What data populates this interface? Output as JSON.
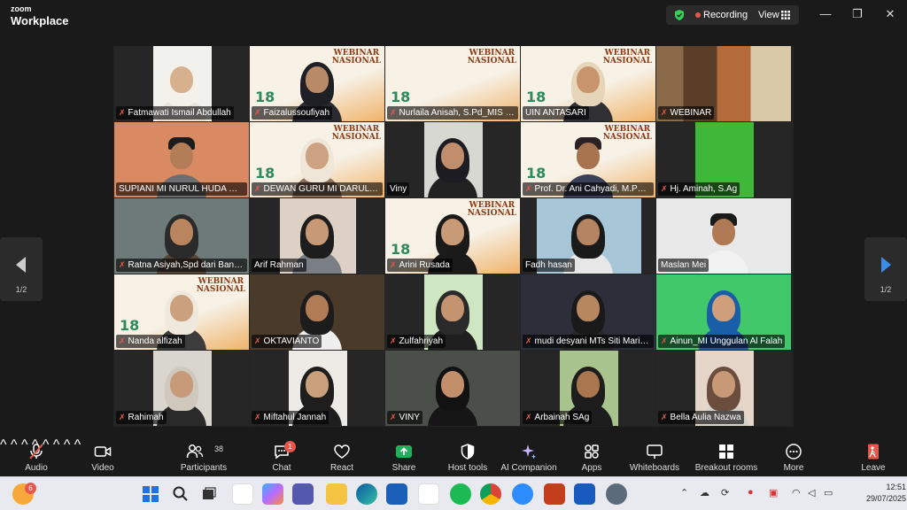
{
  "titlebar": {
    "logo_line1": "zoom",
    "logo_line2": "Workplace",
    "recording_label": "Recording",
    "view_label": "View",
    "minimize": "—",
    "maximize": "❐",
    "close": "✕"
  },
  "gallery": {
    "page_left": "1/2",
    "page_right": "1/2",
    "tiles": [
      {
        "name": "Fatmawati Ismail Abdullah",
        "muted": true
      },
      {
        "name": "Faizalussoufiyah",
        "muted": true
      },
      {
        "name": "Nurlaila Anisah, S.Pd_MIS Nurul Hikmah",
        "muted": true
      },
      {
        "name": "UIN ANTASARI",
        "muted": false
      },
      {
        "name": "WEBINAR",
        "muted": true
      },
      {
        "name": "SUPIANI MI NURUL HUDA MANDIANGIN",
        "muted": false
      },
      {
        "name": "DEWAN GURU MI DARUL FALAH",
        "muted": true
      },
      {
        "name": "Viny",
        "muted": false
      },
      {
        "name": "Prof. Dr. Ani Cahyadi, M.Pd/UIN",
        "muted": true
      },
      {
        "name": "Hj. Aminah, S.Ag",
        "muted": true
      },
      {
        "name": "Ratna Asiyah,Spd dari Banjarbaru",
        "muted": true
      },
      {
        "name": "Arif Rahman",
        "muted": false
      },
      {
        "name": "Arini Rusada",
        "muted": true
      },
      {
        "name": "Fadh hasan",
        "muted": false
      },
      {
        "name": "Maslan Mei",
        "muted": false
      },
      {
        "name": "Nanda alfizah",
        "muted": true
      },
      {
        "name": "OKTAVIANTO",
        "muted": true
      },
      {
        "name": "Zulfahriyah",
        "muted": true
      },
      {
        "name": "mudi desyani MTs Siti Mariam",
        "muted": true
      },
      {
        "name": "Ainun_MI Unggulan Al Falah",
        "muted": true
      },
      {
        "name": "Rahimah",
        "muted": true
      },
      {
        "name": "Miftahul Jannah",
        "muted": true
      },
      {
        "name": "VINY",
        "muted": true
      },
      {
        "name": "Arbainah SAg",
        "muted": true
      },
      {
        "name": "Bella Aulia Nazwa",
        "muted": true
      }
    ],
    "poster_title_1": "WEBINAR",
    "poster_title_2": "NASIONAL",
    "poster_number": "18"
  },
  "toolbar": {
    "audio": "Audio",
    "video": "Video",
    "participants": "Participants",
    "participants_count": "38",
    "chat": "Chat",
    "chat_badge": "1",
    "react": "React",
    "share": "Share",
    "host_tools": "Host tools",
    "ai_companion": "AI Companion",
    "apps": "Apps",
    "whiteboards": "Whiteboards",
    "breakout_rooms": "Breakout rooms",
    "more": "More",
    "leave": "Leave"
  },
  "taskbar": {
    "notification_badge": "6",
    "time": "12:51",
    "date": "29/07/2025"
  },
  "colors": {
    "accent_green": "#35d155",
    "recording_red": "#e8574b",
    "share_green": "#1fb15a"
  }
}
